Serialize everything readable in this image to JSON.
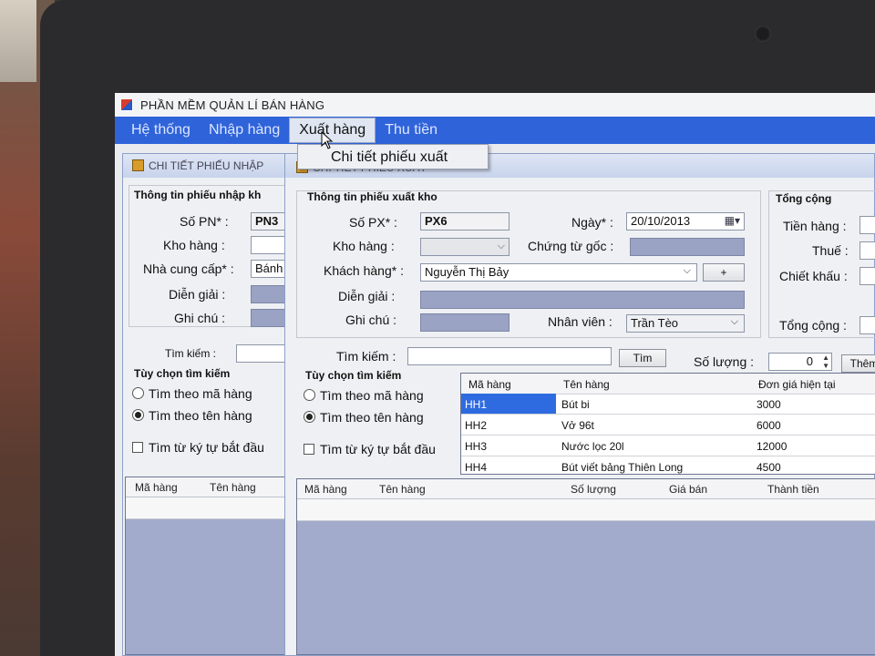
{
  "app": {
    "title": "PHẦN MỀM QUẢN LÍ BÁN HÀNG"
  },
  "menu": {
    "items": [
      {
        "label": "Hệ thống"
      },
      {
        "label": "Nhập hàng"
      },
      {
        "label": "Xuất hàng"
      },
      {
        "label": "Thu tiền"
      }
    ],
    "open_dropdown": {
      "items": [
        {
          "label": "Chi tiết phiếu xuất"
        }
      ]
    }
  },
  "phieu_nhap": {
    "window_title": "CHI TIẾT PHIẾU NHẬP",
    "group_title": "Thông tin phiếu nhập kh",
    "so_pn_label": "Số PN* :",
    "so_pn_value": "PN3",
    "kho_hang_label": "Kho hàng :",
    "ncc_label": "Nhà cung cấp* :",
    "ncc_value": "Bánh",
    "dien_giai_label": "Diễn giải :",
    "ghi_chu_label": "Ghi chú :",
    "tim_kiem_label": "Tìm kiếm :",
    "tuy_chon_label": "Tùy chọn tìm kiếm",
    "opt_ma": "Tìm theo mã hàng",
    "opt_ten": "Tìm theo tên hàng",
    "opt_tu_dau": "Tìm từ ký tự bắt đầu",
    "grid_cols": [
      "Mã hàng",
      "Tên hàng"
    ]
  },
  "phieu_xuat": {
    "window_title": "CHI TIẾT PHIẾU XUẤT",
    "group_title": "Thông tin phiếu xuất kho",
    "so_px_label": "Số PX* :",
    "so_px_value": "PX6",
    "ngay_label": "Ngày* :",
    "ngay_value": "20/10/2013",
    "kho_hang_label": "Kho hàng :",
    "chung_tu_label": "Chứng từ gốc :",
    "khach_hang_label": "Khách hàng* :",
    "khach_hang_value": "Nguyễn Thị Bảy",
    "add_button": "+",
    "dien_giai_label": "Diễn giải :",
    "ghi_chu_label": "Ghi chú :",
    "nhan_vien_label": "Nhân viên :",
    "nhan_vien_value": "Trần Tèo",
    "tim_kiem_label": "Tìm kiếm :",
    "tim_button": "Tìm",
    "so_luong_label": "Số lượng :",
    "so_luong_value": "0",
    "them_button": "Thêm",
    "tuy_chon_label": "Tùy chọn tìm kiếm",
    "opt_ma": "Tìm theo mã hàng",
    "opt_ten": "Tìm theo tên hàng",
    "opt_tu_dau": "Tìm từ ký tự bắt đầu",
    "products": {
      "cols": [
        "Mã hàng",
        "Tên hàng",
        "Đơn giá hiện tại"
      ],
      "rows": [
        {
          "ma": "HH1",
          "ten": "Bút bi",
          "gia": "3000"
        },
        {
          "ma": "HH2",
          "ten": "Vở 96t",
          "gia": "6000"
        },
        {
          "ma": "HH3",
          "ten": "Nước lọc 20l",
          "gia": "12000"
        },
        {
          "ma": "HH4",
          "ten": "Bút viết bảng Thiên Long",
          "gia": "4500"
        }
      ]
    },
    "detail_cols": [
      "Mã hàng",
      "Tên hàng",
      "Số lượng",
      "Giá bán",
      "Thành tiền"
    ]
  },
  "tong_cong": {
    "title": "Tổng cộng",
    "tien_hang": "Tiền hàng :",
    "thue": "Thuế :",
    "chiet_khau": "Chiết khấu :",
    "tong_cong": "Tổng cộng :"
  },
  "colors": {
    "menubar": "#2f63d9",
    "selection": "#2f6be0",
    "grid_bg": "#a2abcb"
  }
}
